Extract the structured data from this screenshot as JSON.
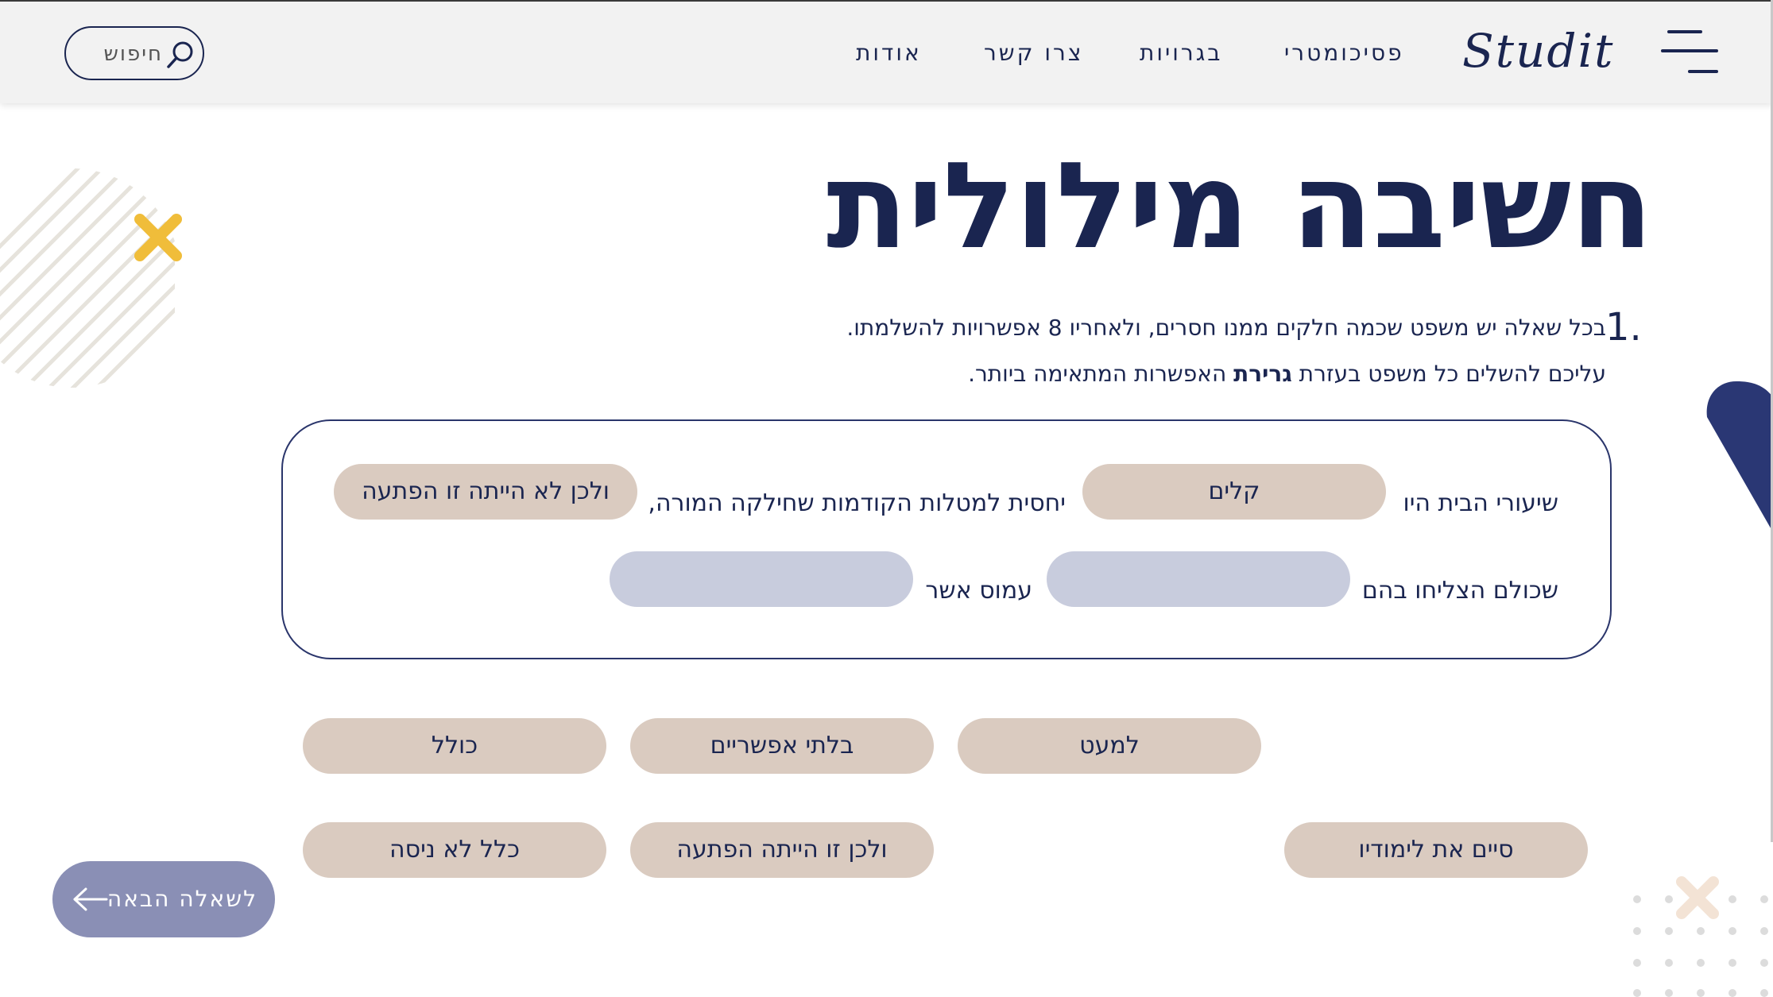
{
  "header": {
    "logo": "Studit",
    "nav": [
      "פסיכומטרי",
      "בגרויות",
      "צרו קשר",
      "אודות"
    ],
    "search": {
      "placeholder": "חיפוש"
    }
  },
  "page": {
    "title": "חשיבה מילולית",
    "question_number": "1.",
    "instruction_line1": "בכל שאלה יש משפט שכמה חלקים ממנו חסרים, ולאחריו 8 אפשרויות להשלמתו.",
    "instruction_line2_prefix": "עליכם להשלים כל משפט בעזרת",
    "instruction_line2_bold": "גרירת",
    "instruction_line2_suffix": "האפשרות המתאימה ביותר."
  },
  "sentence": {
    "part1": "שיעורי הבית היו",
    "part2": "יחסית למטלות הקודמות שחילקה המורה,",
    "part3": "שכולם הצליחו בהם",
    "part4": "עמוס אשר",
    "placed": [
      "קלים",
      "ולכן לא הייתה זו הפתעה"
    ]
  },
  "options": [
    "למעט",
    "בלתי אפשריים",
    "כולל",
    "סיים את לימודיו",
    "ולכן זו הייתה הפתעה",
    "כלל לא ניסה"
  ],
  "next_button": {
    "label": "לשאלה הבאה"
  },
  "colors": {
    "primary": "#1a2550",
    "pill": "#dacbc0",
    "slot": "#c8ccdd",
    "button": "#8a8fb5",
    "accent": "#f0bd3a"
  }
}
